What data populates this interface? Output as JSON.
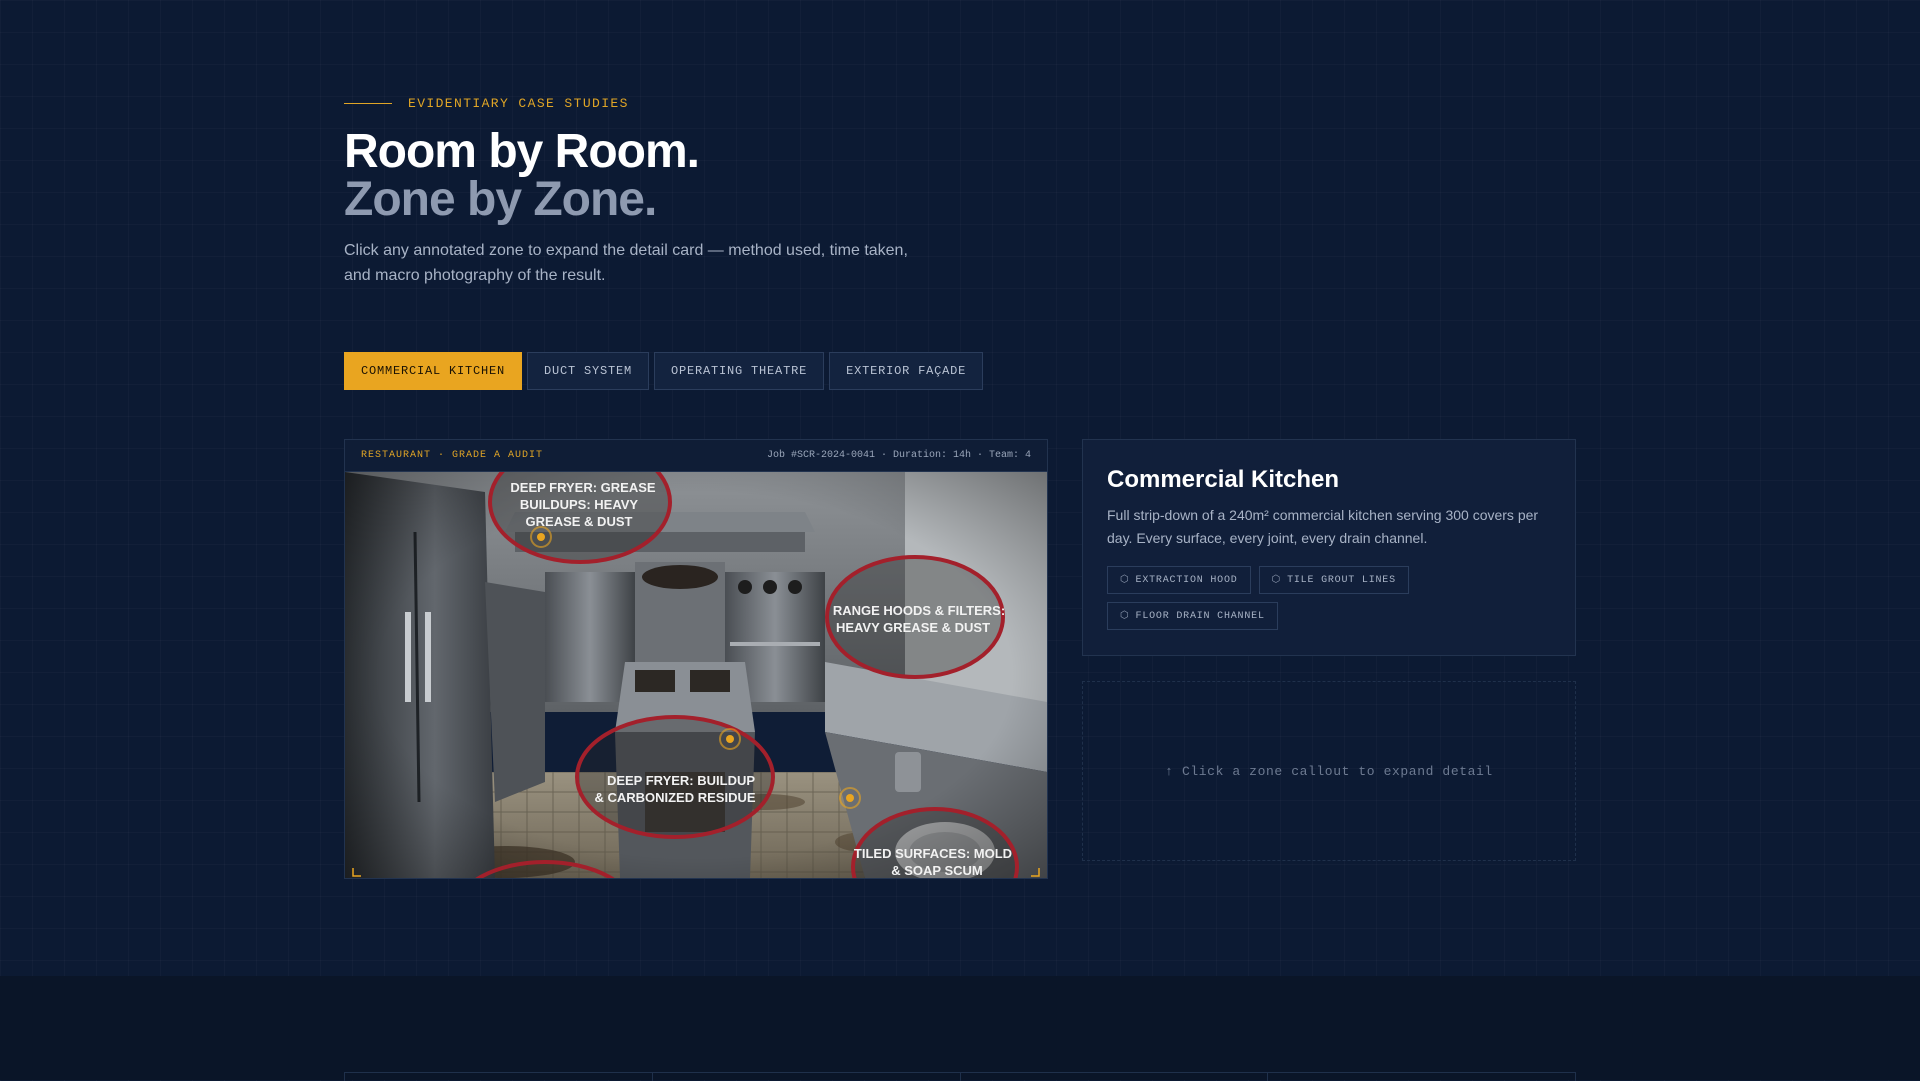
{
  "header": {
    "eyebrow": "EVIDENTIARY CASE STUDIES",
    "title_line1": "Room by Room.",
    "title_line2": "Zone by Zone.",
    "lede": "Click any annotated zone to expand the detail card — method used, time taken, and macro photography of the result."
  },
  "tabs": [
    {
      "label": "COMMERCIAL KITCHEN",
      "active": true
    },
    {
      "label": "DUCT SYSTEM",
      "active": false
    },
    {
      "label": "OPERATING THEATRE",
      "active": false
    },
    {
      "label": "EXTERIOR FAÇADE",
      "active": false
    }
  ],
  "viewer": {
    "category": "RESTAURANT · GRADE A AUDIT",
    "meta": "Job #SCR-2024-0041 · Duration: 14h · Team: 4",
    "callouts": [
      {
        "line1": "DEEP FRYER: GREASE",
        "line2": "BUILDUPS: HEAVY",
        "line3": "GREASE & DUST"
      },
      {
        "line1": "RANGE HOODS & FILTERS:",
        "line2": "HEAVY GREASE & DUST"
      },
      {
        "line1": "DEEP FRYER: BUILDUP",
        "line2": "& CARBONIZED RESIDUE"
      },
      {
        "line1": "TILED SURFACES: MOLD",
        "line2": "& SOAP SCUM"
      }
    ]
  },
  "card": {
    "title": "Commercial Kitchen",
    "description": "Full strip-down of a 240m² commercial kitchen serving 300 covers per day. Every surface, every joint, every drain channel.",
    "tags": [
      "EXTRACTION HOOD",
      "TILE GROUT LINES",
      "FLOOR DRAIN CHANNEL"
    ],
    "tag_icon": "⬡"
  },
  "placeholder": {
    "text": "↑ Click a zone callout to expand detail"
  },
  "colors": {
    "accent": "#e9a520",
    "background": "#0c1a33",
    "callout_ring": "#a3202b"
  }
}
